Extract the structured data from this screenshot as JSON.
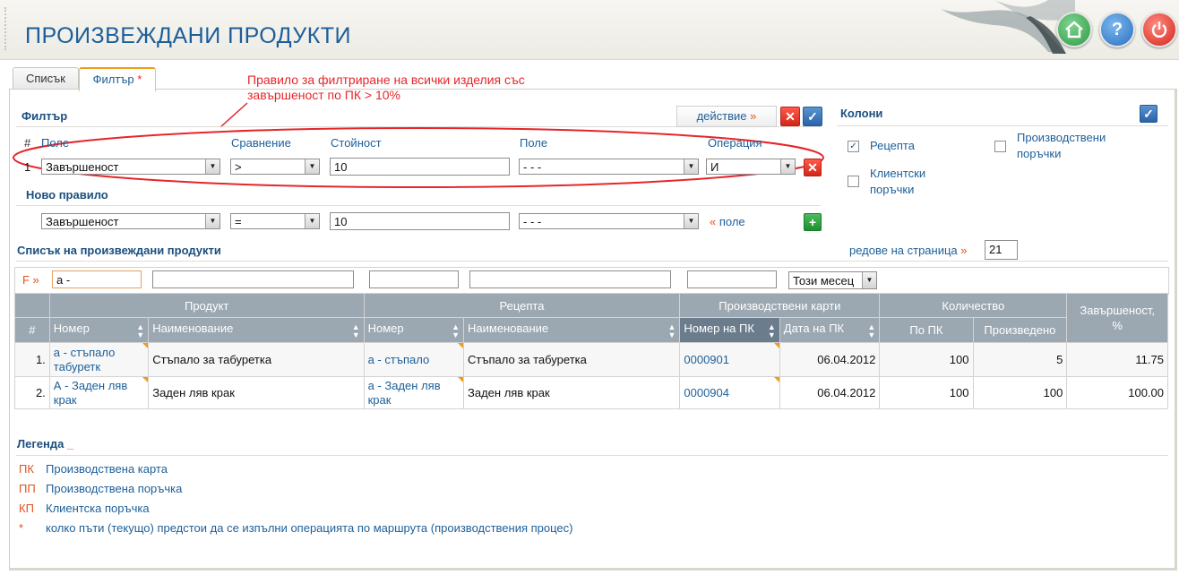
{
  "header": {
    "title": "ПРОИЗВЕЖДАНИ ПРОДУКТИ",
    "home_icon": "home-icon",
    "help_label": "?",
    "power_icon": "power-icon"
  },
  "tabs": [
    {
      "label": "Списък"
    },
    {
      "label": "Филтър",
      "marker": "*"
    }
  ],
  "annotation": {
    "line1": "Правило за филтриране на всички изделия със",
    "line2": "завършеност по ПК > 10%"
  },
  "filter": {
    "title": "Филтър",
    "action_label": "действие",
    "action_arrow": "»",
    "columns": {
      "num": "#",
      "field": "Поле",
      "comparison": "Сравнение",
      "value": "Стойност",
      "field2": "Поле",
      "operation": "Операция"
    },
    "rule": {
      "num": "1",
      "field": "Завършеност",
      "comparison": ">",
      "value": "10",
      "field2": "- - -",
      "operation": "И"
    },
    "new_rule_title": "Ново правило",
    "new_rule": {
      "field": "Завършеност",
      "comparison": "=",
      "value": "10",
      "field2": "- - -",
      "add_field_arrow": "«",
      "add_field_label": "поле"
    }
  },
  "columns_panel": {
    "title": "Колони",
    "options": [
      {
        "label": "Рецепта",
        "checked": true
      },
      {
        "label": "Производствени поръчки",
        "checked": false
      },
      {
        "label": "Клиентски поръчки",
        "checked": false
      }
    ]
  },
  "list": {
    "title": "Списък на произвеждани продукти",
    "rows_per_page_label": "редове на страница",
    "rows_per_page_arrow": "»",
    "rows_per_page_value": "21",
    "filter_row": {
      "prefix": "F »",
      "product_number": "а -",
      "date_option": "Този месец"
    },
    "group_headers": {
      "product": "Продукт",
      "recipe": "Рецепта",
      "cards": "Производствени карти",
      "quantity": "Количество",
      "completion": "Завършеност, %"
    },
    "headers": {
      "num": "#",
      "product_number": "Номер",
      "product_name": "Наименование",
      "recipe_number": "Номер",
      "recipe_name": "Наименование",
      "card_number": "Номер на ПК",
      "card_date": "Дата на ПК",
      "qty_card": "По ПК",
      "qty_produced": "Произведено"
    },
    "rows": [
      {
        "num": "1.",
        "product_number": "а - стъпало табуретк",
        "product_name": "Стъпало за табуретка",
        "recipe_number": "а - стъпало",
        "recipe_name": "Стъпало за табуретка",
        "card_number": "0000901",
        "card_date": "06.04.2012",
        "qty_card": "100",
        "qty_produced": "5",
        "completion": "11.75"
      },
      {
        "num": "2.",
        "product_number": "А - Заден ляв крак",
        "product_name": "Заден ляв крак",
        "recipe_number": "а - Заден ляв крак",
        "recipe_name": "Заден ляв крак",
        "card_number": "0000904",
        "card_date": "06.04.2012",
        "qty_card": "100",
        "qty_produced": "100",
        "completion": "100.00"
      }
    ]
  },
  "legend": {
    "title": "Легенда",
    "collapse_marker": "_",
    "items": [
      {
        "abbr": "ПК",
        "desc": "Производствена карта"
      },
      {
        "abbr": "ПП",
        "desc": "Производствена поръчка"
      },
      {
        "abbr": "КП",
        "desc": "Клиентска поръчка"
      },
      {
        "abbr": "*",
        "desc": "колко пъти (текущо) предстои да се изпълни операцията по маршрута (производствения процес)"
      }
    ]
  },
  "colors": {
    "title_blue": "#1c5e9a",
    "link_blue": "#1d5f99",
    "accent_orange": "#e1531d",
    "annotation_red": "#e5262a",
    "header_gray": "#9ba7b1"
  }
}
